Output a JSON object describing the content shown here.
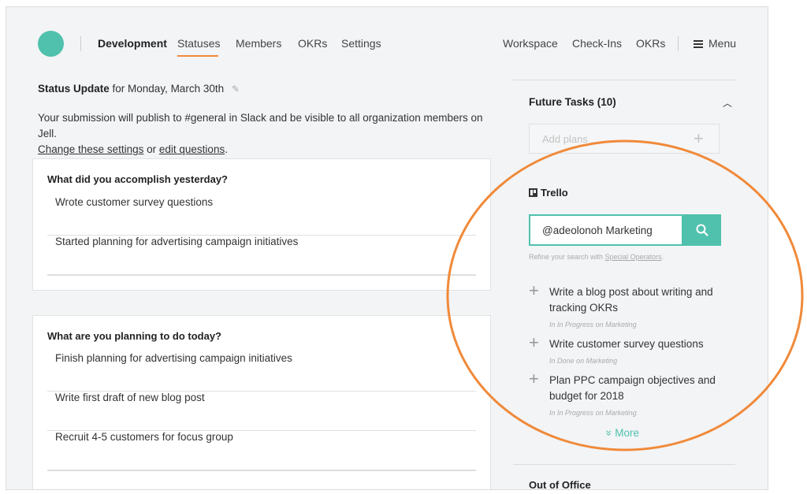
{
  "nav": {
    "brand": "Development",
    "left_tabs": [
      "Statuses",
      "Members",
      "OKRs",
      "Settings"
    ],
    "active_tab": "Statuses",
    "right_links": [
      "Workspace",
      "Check-Ins",
      "OKRs"
    ],
    "menu_label": "Menu",
    "accent_color": "#f08a3a"
  },
  "status": {
    "title_bold": "Status Update",
    "title_rest": "for Monday, March 30th",
    "desc_line1": "Your submission will publish to #general in Slack and be visible to all organization members on Jell.",
    "change_link": "Change these settings",
    "or_text": "or",
    "edit_link": "edit questions",
    "period": "."
  },
  "questions": [
    {
      "question": "What did you accomplish yesterday?",
      "answers": [
        "Wrote customer survey questions",
        "Started planning for advertising campaign initiatives",
        ""
      ]
    },
    {
      "question": "What are you planning to do today?",
      "answers": [
        "Finish planning for advertising campaign initiatives",
        "Write first draft of new blog post",
        "Recruit 4-5 customers for focus group",
        ""
      ]
    }
  ],
  "sidebar": {
    "future_tasks_title": "Future Tasks (10)",
    "add_plans_placeholder": "Add plans",
    "trello_title": "Trello",
    "search_value": "@adeolonoh Marketing",
    "refine_prefix": "Refine your search with",
    "refine_link": "Special Operators",
    "refine_suffix": ".",
    "tasks": [
      {
        "text": "Write a blog post about writing and tracking OKRs",
        "meta_in": "In",
        "meta_list": "In Progress",
        "meta_on": "on",
        "meta_board": "Marketing"
      },
      {
        "text": "Write customer survey questions",
        "meta_in": "In",
        "meta_list": "Done",
        "meta_on": "on",
        "meta_board": "Marketing"
      },
      {
        "text": "Plan PPC campaign objectives and budget for 2018",
        "meta_in": "In",
        "meta_list": "In Progress",
        "meta_on": "on",
        "meta_board": "Marketing"
      }
    ],
    "more_label": "More",
    "out_of_office_title": "Out of Office",
    "brand_color": "#4fc1ad"
  }
}
